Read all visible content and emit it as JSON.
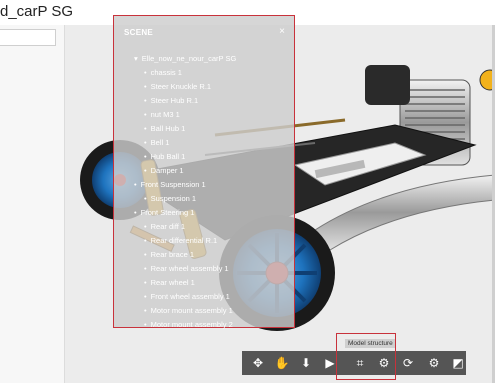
{
  "header": {
    "title": "d_carP SG"
  },
  "left_panel": {
    "search_value": ""
  },
  "scene_panel": {
    "title": "SCENE",
    "close": "×",
    "tree": [
      {
        "label": "Elle_now_ne_nour_carP SG",
        "indent": 0,
        "marker": "▾"
      },
      {
        "label": "chassis 1",
        "indent": 1,
        "marker": "•"
      },
      {
        "label": "Steer Knuckle R.1",
        "indent": 1,
        "marker": "•"
      },
      {
        "label": "Steer Hub R.1",
        "indent": 1,
        "marker": "•"
      },
      {
        "label": "nut M3 1",
        "indent": 1,
        "marker": "•"
      },
      {
        "label": "Ball Hub 1",
        "indent": 1,
        "marker": "•"
      },
      {
        "label": "Bell 1",
        "indent": 1,
        "marker": "•"
      },
      {
        "label": "Hub Ball 1",
        "indent": 1,
        "marker": "•"
      },
      {
        "label": "Damper 1",
        "indent": 1,
        "marker": "•"
      },
      {
        "label": "Front Suspension 1",
        "indent": 0,
        "marker": "•"
      },
      {
        "label": "Suspension 1",
        "indent": 1,
        "marker": "•"
      },
      {
        "label": "Front Steering 1",
        "indent": 0,
        "marker": "•"
      },
      {
        "label": "Rear diff 1",
        "indent": 1,
        "marker": "•"
      },
      {
        "label": "Rear differential R.1",
        "indent": 1,
        "marker": "•"
      },
      {
        "label": "Rear brace 1",
        "indent": 1,
        "marker": "•"
      },
      {
        "label": "Rear wheel assembly 1",
        "indent": 1,
        "marker": "•"
      },
      {
        "label": "Rear wheel 1",
        "indent": 1,
        "marker": "•"
      },
      {
        "label": "Front wheel assembly 1",
        "indent": 1,
        "marker": "•"
      },
      {
        "label": "Motor mount assembly 1",
        "indent": 1,
        "marker": "•"
      },
      {
        "label": "Motor mount assembly 2",
        "indent": 1,
        "marker": "•"
      }
    ]
  },
  "tooltip": {
    "text": "Model structure"
  },
  "toolbar": [
    {
      "icon": "move-axes-icon",
      "glyph": "✥"
    },
    {
      "icon": "hand-pan-icon",
      "glyph": "✋"
    },
    {
      "icon": "arrow-down-icon",
      "glyph": "⬇"
    },
    {
      "icon": "camera-icon",
      "glyph": "▶"
    },
    {
      "icon": "model-structure-icon",
      "glyph": "⌗"
    },
    {
      "icon": "parts-icon",
      "glyph": "⚙"
    },
    {
      "icon": "refresh-icon",
      "glyph": "⟳"
    },
    {
      "icon": "settings-icon",
      "glyph": "⚙"
    },
    {
      "icon": "section-icon",
      "glyph": "◩"
    }
  ],
  "colors": {
    "highlight": "#c8323b",
    "wheel_blue": "#1e73be",
    "spring_yellow": "#f2b21c",
    "tire": "#1a1a1a"
  }
}
